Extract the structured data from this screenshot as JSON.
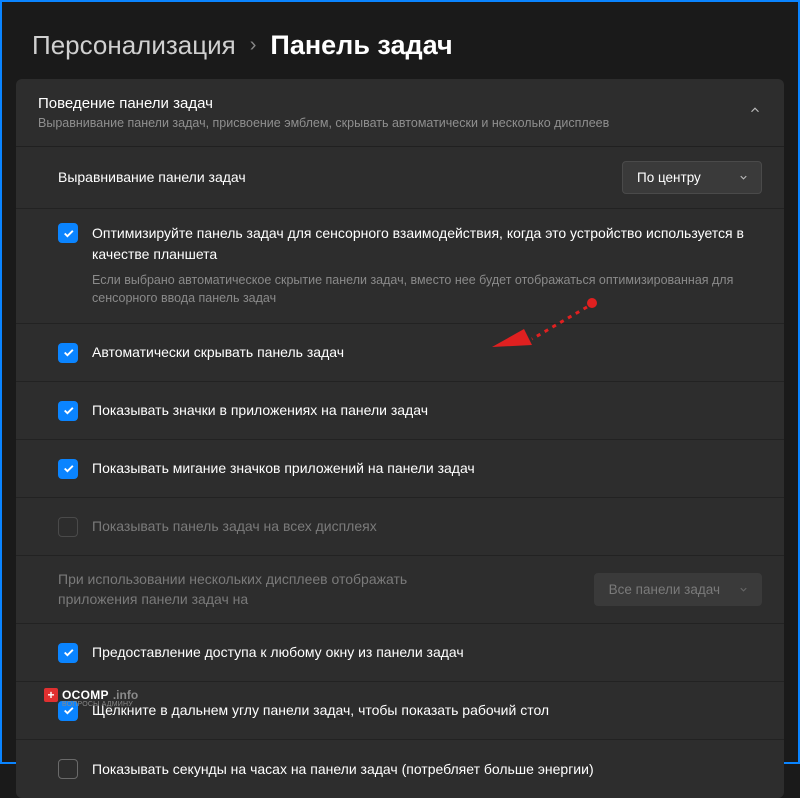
{
  "breadcrumb": {
    "parent": "Персонализация",
    "separator": "›",
    "current": "Панель задач"
  },
  "panel": {
    "title": "Поведение панели задач",
    "subtitle": "Выравнивание панели задач, присвоение эмблем, скрывать автоматически и несколько дисплеев"
  },
  "alignment": {
    "label": "Выравнивание панели задач",
    "value": "По центру"
  },
  "optimize": {
    "label": "Оптимизируйте панель задач для сенсорного взаимодействия, когда это устройство используется в качестве планшета",
    "desc": "Если выбрано автоматическое скрытие панели задач, вместо нее будет отображаться оптимизированная для сенсорного ввода панель задач"
  },
  "items": [
    {
      "label": "Автоматически скрывать панель задач",
      "checked": true
    },
    {
      "label": "Показывать значки в приложениях на панели задач",
      "checked": true
    },
    {
      "label": "Показывать мигание значков приложений на панели задач",
      "checked": true
    },
    {
      "label": "Показывать панель задач на всех дисплеях",
      "checked": false,
      "disabled": true
    }
  ],
  "multidisplay": {
    "label": "При использовании нескольких дисплеев отображать приложения панели задач на",
    "value": "Все панели задач",
    "disabled": true
  },
  "items2": [
    {
      "label": "Предоставление доступа к любому окну из панели задач",
      "checked": true
    },
    {
      "label": "Щелкните в дальнем углу панели задач, чтобы показать рабочий стол",
      "checked": true
    },
    {
      "label": "Показывать секунды на часах на панели задач (потребляет больше энергии)",
      "checked": false
    }
  ],
  "watermark": {
    "name": "OCOMP",
    "suffix": ".info",
    "sub": "ВОПРОСЫ АДМИНУ"
  }
}
